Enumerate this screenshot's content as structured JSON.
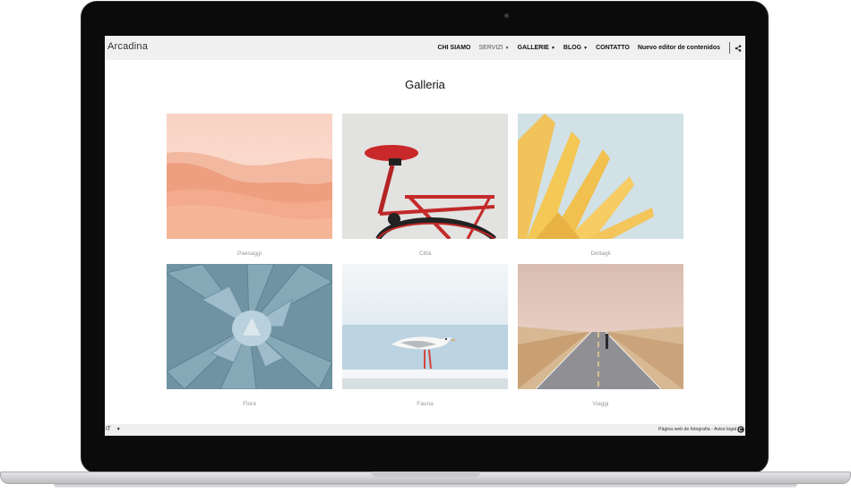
{
  "site": {
    "logo": "Arcadina",
    "nav": [
      {
        "label": "CHI SIAMO"
      },
      {
        "label": "SERVIZI"
      },
      {
        "label": "GALLERIE"
      },
      {
        "label": "BLOG"
      },
      {
        "label": "CONTATTO"
      },
      {
        "label": "Nuevo editor de contenidos"
      }
    ]
  },
  "page": {
    "title": "Galleria",
    "galleries": [
      {
        "caption": "Paesaggi",
        "icon": "desert-landscape-photo"
      },
      {
        "caption": "Città",
        "icon": "red-bicycle-photo"
      },
      {
        "caption": "Dettagli",
        "icon": "yellow-leaves-photo"
      },
      {
        "caption": "Flora",
        "icon": "succulent-plant-photo"
      },
      {
        "caption": "Fauna",
        "icon": "seagull-photo"
      },
      {
        "caption": "Viaggi",
        "icon": "road-traveler-photo"
      }
    ]
  },
  "footer": {
    "language": "IT",
    "legal": "Página web de fotografía - Aviso legal"
  },
  "colors": {
    "topbar": "#f0f0f0",
    "caption": "#999999",
    "laptop_bezel": "#0b0b0b"
  }
}
